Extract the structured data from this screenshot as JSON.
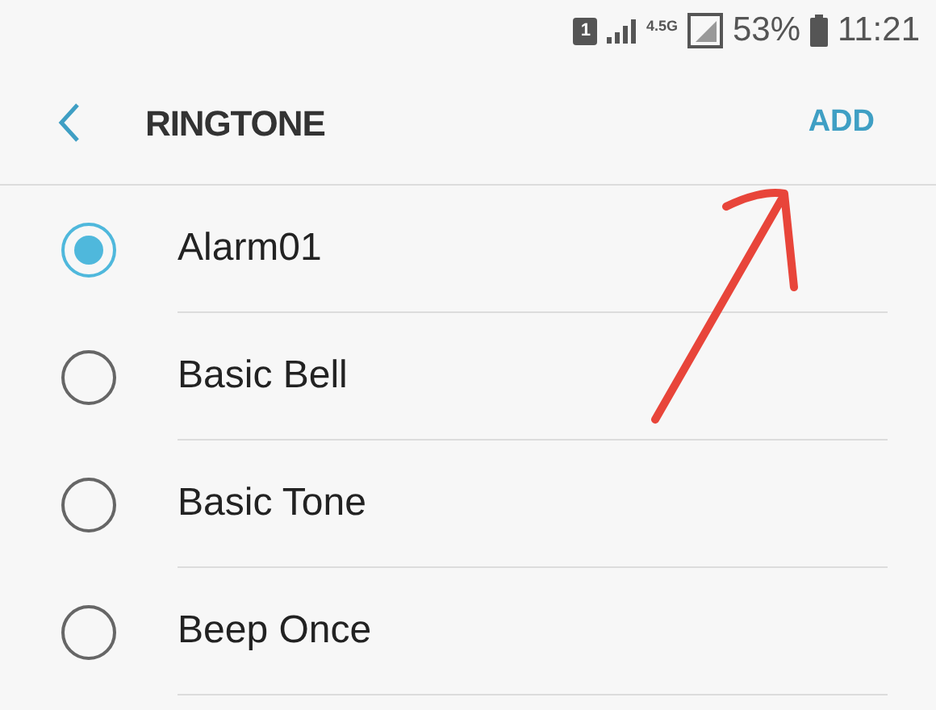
{
  "status_bar": {
    "sim": "1",
    "network": "4.5G",
    "battery": "53%",
    "time": "11:21"
  },
  "header": {
    "title": "RINGTONE",
    "action": "ADD"
  },
  "ringtones": [
    {
      "label": "Alarm01",
      "selected": true
    },
    {
      "label": "Basic Bell",
      "selected": false
    },
    {
      "label": "Basic Tone",
      "selected": false
    },
    {
      "label": "Beep Once",
      "selected": false
    }
  ]
}
